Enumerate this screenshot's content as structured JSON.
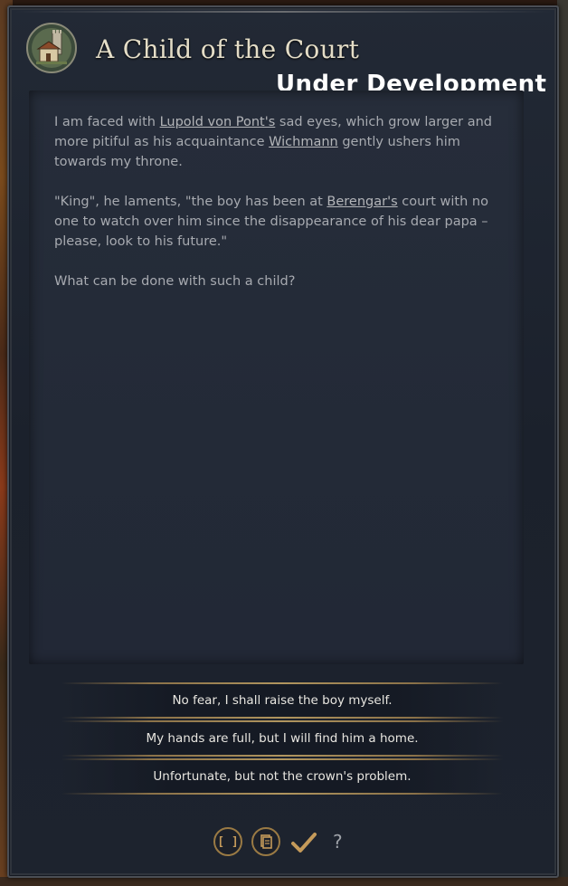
{
  "event": {
    "title": "A Child of the Court",
    "overlay_label": "Under Development",
    "paragraphs": [
      {
        "parts": [
          "I am faced with ",
          "Lupold von Pont's",
          " sad eyes, which grow larger and more pitiful as his acquaintance ",
          "Wichmann",
          " gently ushers him towards my throne."
        ]
      },
      {
        "parts": [
          "\"King\", he laments, \"the boy has been at ",
          "Berengar's",
          " court with no one to watch over him since the disappearance of his dear papa – please, look to his future.\""
        ]
      },
      {
        "parts": [
          "What can be done with such a child?"
        ]
      }
    ],
    "options": [
      "No fear, I shall raise the boy myself.",
      "My hands are full, but I will find him a home.",
      "Unfortunate, but not the crown's problem."
    ]
  },
  "bottom_bar": {
    "brackets_label": "[ ]",
    "help_label": "?"
  },
  "icons": {
    "emblem": "castle-emblem-icon",
    "brackets": "brackets-icon",
    "scroll": "scroll-icon",
    "check": "checkmark-icon",
    "help": "question-icon"
  },
  "colors": {
    "accent_gold": "#b0955e",
    "panel": "#222836",
    "text": "#a7aab0"
  }
}
